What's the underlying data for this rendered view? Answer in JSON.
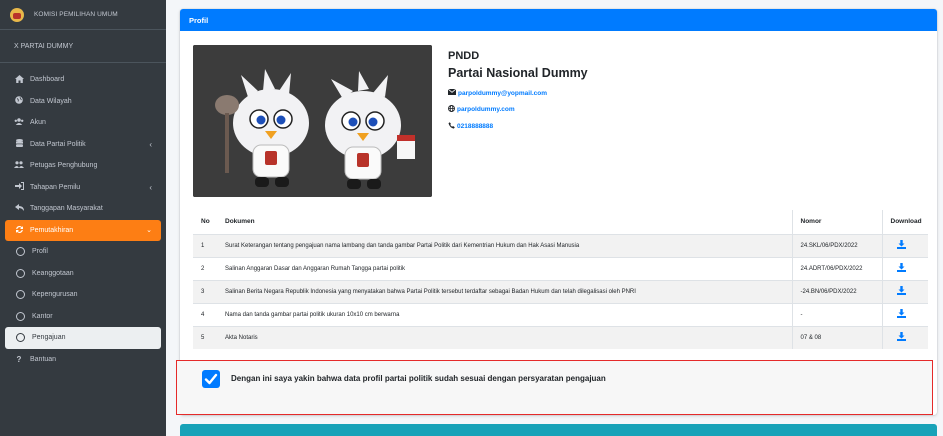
{
  "sidebar": {
    "brand": "KOMISI PEMILIHAN UMUM",
    "party_label": "X PARTAI DUMMY",
    "items": [
      {
        "label": "Dashboard",
        "icon": "home-icon"
      },
      {
        "label": "Data Wilayah",
        "icon": "globe-icon"
      },
      {
        "label": "Akun",
        "icon": "users-icon"
      },
      {
        "label": "Data Partai Politik",
        "icon": "database-icon"
      },
      {
        "label": "Petugas Penghubung",
        "icon": "people-icon"
      },
      {
        "label": "Tahapan Pemilu",
        "icon": "sign-in-icon"
      },
      {
        "label": "Tanggapan Masyarakat",
        "icon": "reply-icon"
      },
      {
        "label": "Pemutakhiran",
        "icon": "sync-icon"
      }
    ],
    "sub_items": [
      "Profil",
      "Keanggotaan",
      "Kepengurusan",
      "Kantor",
      "Pengajuan"
    ],
    "help": "Bantuan"
  },
  "card": {
    "title": "Profil"
  },
  "profile": {
    "abbr": "PNDD",
    "name": "Partai Nasional Dummy",
    "email": "parpoldummy@yopmail.com",
    "website": "parpoldummy.com",
    "phone": "0218888888"
  },
  "table": {
    "headers": [
      "No",
      "Dokumen",
      "Nomor",
      "Download"
    ],
    "rows": [
      {
        "no": "1",
        "doc": "Surat Keterangan tentang pengajuan nama lambang dan tanda gambar Partai Politik dari Kementrian Hukum dan Hak Asasi Manusia",
        "nomor": "24.SKL/06/PDX/2022"
      },
      {
        "no": "2",
        "doc": "Salinan Anggaran Dasar dan Anggaran Rumah Tangga partai politik",
        "nomor": "24.ADRT/06/PDX/2022"
      },
      {
        "no": "3",
        "doc": "Salinan Berita Negara Republik Indonesia yang menyatakan bahwa Partai Politik tersebut terdaftar sebagai Badan Hukum dan telah dilegalisasi oleh PNRI",
        "nomor": "-24.BN/06/PDX/2022"
      },
      {
        "no": "4",
        "doc": "Nama dan tanda gambar partai politik ukuran 10x10 cm berwarna",
        "nomor": "-"
      },
      {
        "no": "5",
        "doc": "Akta Notaris",
        "nomor": "07 & 08"
      }
    ]
  },
  "confirm": {
    "checked": true,
    "text": "Dengan ini saya yakin bahwa data profil partai politik sudah sesuai dengan persyaratan pengajuan"
  },
  "colors": {
    "primary": "#007bff",
    "sidebar": "#343a40",
    "active": "#fd7e14",
    "highlight_border": "#e52a2a",
    "next_header": "#17a2b8"
  }
}
